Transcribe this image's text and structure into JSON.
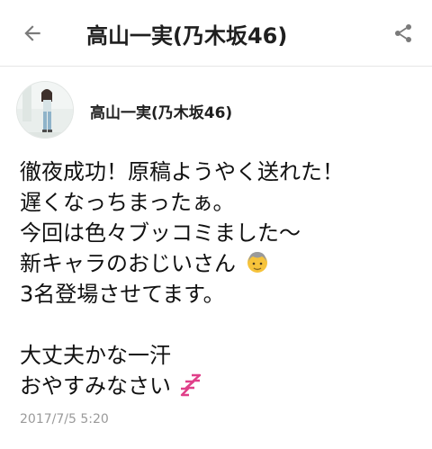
{
  "header": {
    "title": "高山一実(乃木坂46)",
    "back_icon": "arrow-left-icon",
    "share_icon": "share-icon"
  },
  "author": {
    "name": "高山一実(乃木坂46)"
  },
  "post": {
    "lines": [
      "徹夜成功！原稿ようやく送れた！",
      "遅くなっちまったぁ。",
      "今回は色々ブッコミました〜",
      "新キャラのおじいさん",
      "3名登場させてます。",
      "",
      "大丈夫かな一汗",
      "おやすみなさい"
    ],
    "emoji_old_man": "older-man-emoji",
    "emoji_sleep": "zzz-emoji"
  },
  "meta": {
    "timestamp": "2017/7/5 5:20"
  },
  "colors": {
    "text": "#111111",
    "muted": "#9a9a9a",
    "icon": "#7a7a7a",
    "sleep_accent": "#e0408a"
  }
}
